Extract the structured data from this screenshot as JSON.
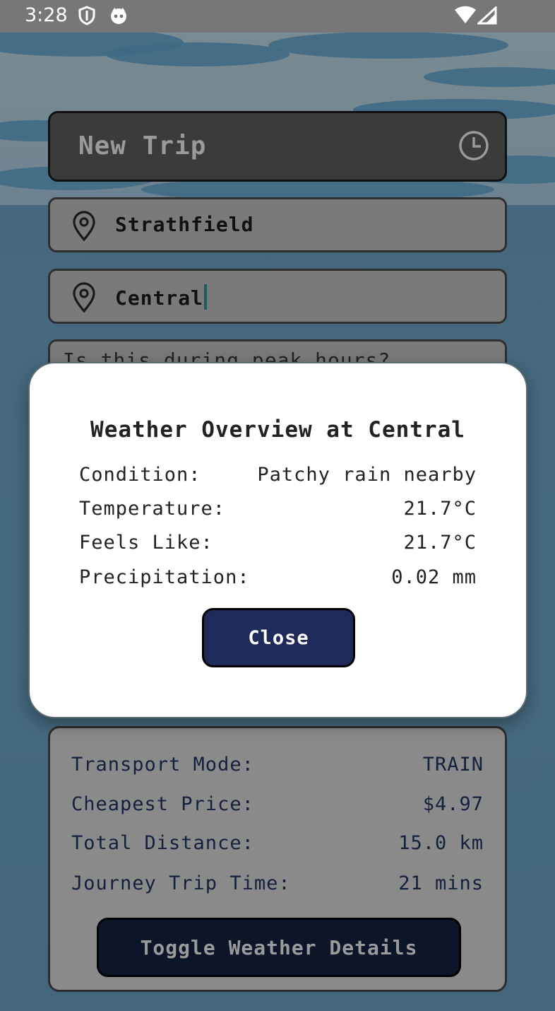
{
  "status_bar": {
    "time": "3:28",
    "left_icons": [
      "shield-icon",
      "cat-icon"
    ],
    "right_icons": [
      "wifi-icon",
      "signal-icon"
    ]
  },
  "trip_form": {
    "title_placeholder": "New Trip",
    "origin": "Strathfield",
    "destination": "Central",
    "peak_question": "Is this during peak hours?"
  },
  "weather_dialog": {
    "title": "Weather Overview at Central",
    "rows": [
      {
        "label": "Condition:",
        "value": "Patchy rain nearby"
      },
      {
        "label": "Temperature:",
        "value": "21.7°C"
      },
      {
        "label": "Feels Like:",
        "value": "21.7°C"
      },
      {
        "label": "Precipitation:",
        "value": "0.02 mm"
      }
    ],
    "close_label": "Close"
  },
  "summary": {
    "rows": [
      {
        "label": "Transport Mode:",
        "value": "TRAIN"
      },
      {
        "label": "Cheapest Price:",
        "value": "$4.97"
      },
      {
        "label": "Total Distance:",
        "value": "15.0 km"
      },
      {
        "label": "Journey Trip Time:",
        "value": "21 mins"
      }
    ],
    "toggle_label": "Toggle Weather Details"
  },
  "colors": {
    "dialog_button": "#1e2a5a",
    "toggle_button": "#0d1529",
    "summary_text": "#14213d",
    "cursor": "#1e5e5a"
  }
}
